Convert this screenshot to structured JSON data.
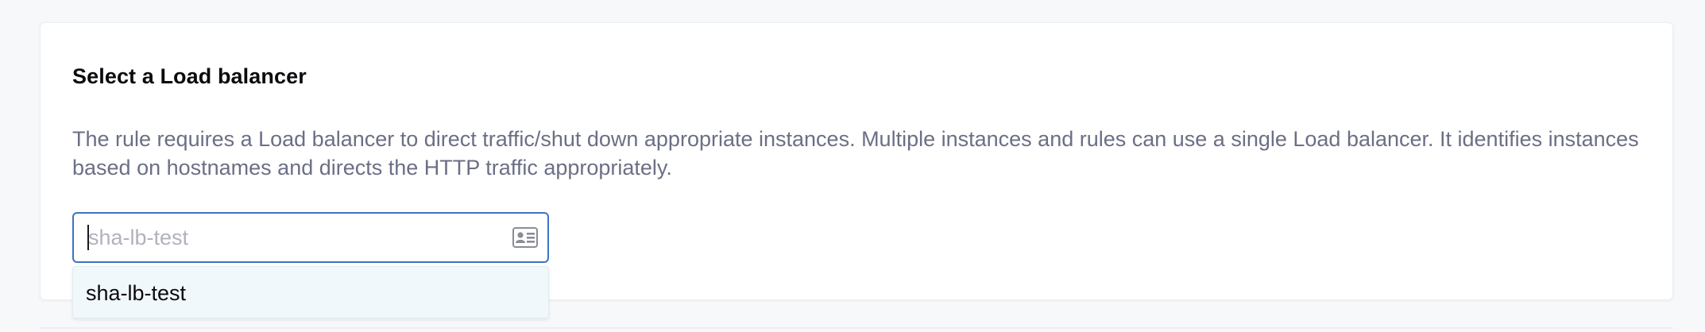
{
  "section": {
    "title": "Select a Load balancer",
    "description": "The rule requires a Load balancer to direct traffic/shut down appropriate instances. Multiple instances and rules can use a single Load balancer. It identifies instances based on hostnames and directs the HTTP traffic appropriately."
  },
  "load_balancer_input": {
    "value": "",
    "placeholder": "sha-lb-test",
    "icon": "contact-card-icon"
  },
  "dropdown": {
    "options": [
      {
        "label": "sha-lb-test"
      }
    ]
  },
  "colors": {
    "accent": "#3b73c9",
    "description_text": "#6b6f85",
    "dropdown_bg": "#f1f8fb"
  }
}
